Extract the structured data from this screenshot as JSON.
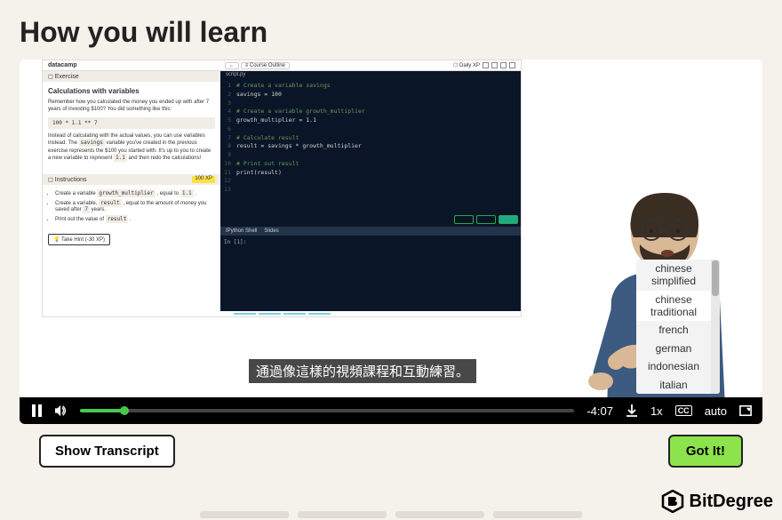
{
  "page": {
    "title": "How you will learn"
  },
  "datacamp": {
    "logo": "datacamp",
    "course_outline": "Course Outline",
    "daily_xp": "Daily XP",
    "exercise_label": "Exercise",
    "exercise_title": "Calculations with variables",
    "para1": "Remember how you calculated the money you ended up with after 7 years of investing $100? You did something like this:",
    "code_block": "100 * 1.1 ** 7",
    "para2_a": "Instead of calculating with the actual values, you can use variables instead. The ",
    "para2_savings": "savings",
    "para2_b": " variable you've created in the previous exercise represents the $100 you started with. It's up to you to create a new variable to represent ",
    "para2_11": "1.1",
    "para2_c": " and then redo the calculations!",
    "instructions_label": "Instructions",
    "xp_reward": "100 XP",
    "instr1_a": "Create a variable ",
    "instr1_var": "growth_multiplier",
    "instr1_b": " , equal to ",
    "instr1_val": "1.1",
    "instr2_a": "Create a variable, ",
    "instr2_var": "result",
    "instr2_b": " , equal to the amount of money you saved after ",
    "instr2_yrs": "7",
    "instr2_c": " years.",
    "instr3_a": "Print out the value of ",
    "instr3_var": "result",
    "hint_btn": "Take Hint (-30 XP)",
    "editor_tab": "script.py",
    "code": {
      "l1": "# Create a variable savings",
      "l2": "savings = 100",
      "l4": "# Create a variable growth_multiplier",
      "l5": "growth_multiplier = 1.1",
      "l7": "# Calculate result",
      "l8": "result = savings * growth_multiplier",
      "l10": "# Print out result",
      "l11": "print(result)"
    },
    "shell_tab1": "IPython Shell",
    "shell_tab2": "Slides",
    "shell_prompt": "In [1]:"
  },
  "caption": "通過像這樣的視頻課程和互動練習。",
  "languages": {
    "items": [
      "chinese simplified",
      "chinese traditional",
      "french",
      "german",
      "indonesian",
      "italian"
    ],
    "selected_index": 1
  },
  "controls": {
    "time_remaining": "-4:07",
    "speed": "1x",
    "quality": "auto"
  },
  "buttons": {
    "transcript": "Show Transcript",
    "gotit": "Got It!"
  },
  "watermark": {
    "text": "BitDegree"
  }
}
